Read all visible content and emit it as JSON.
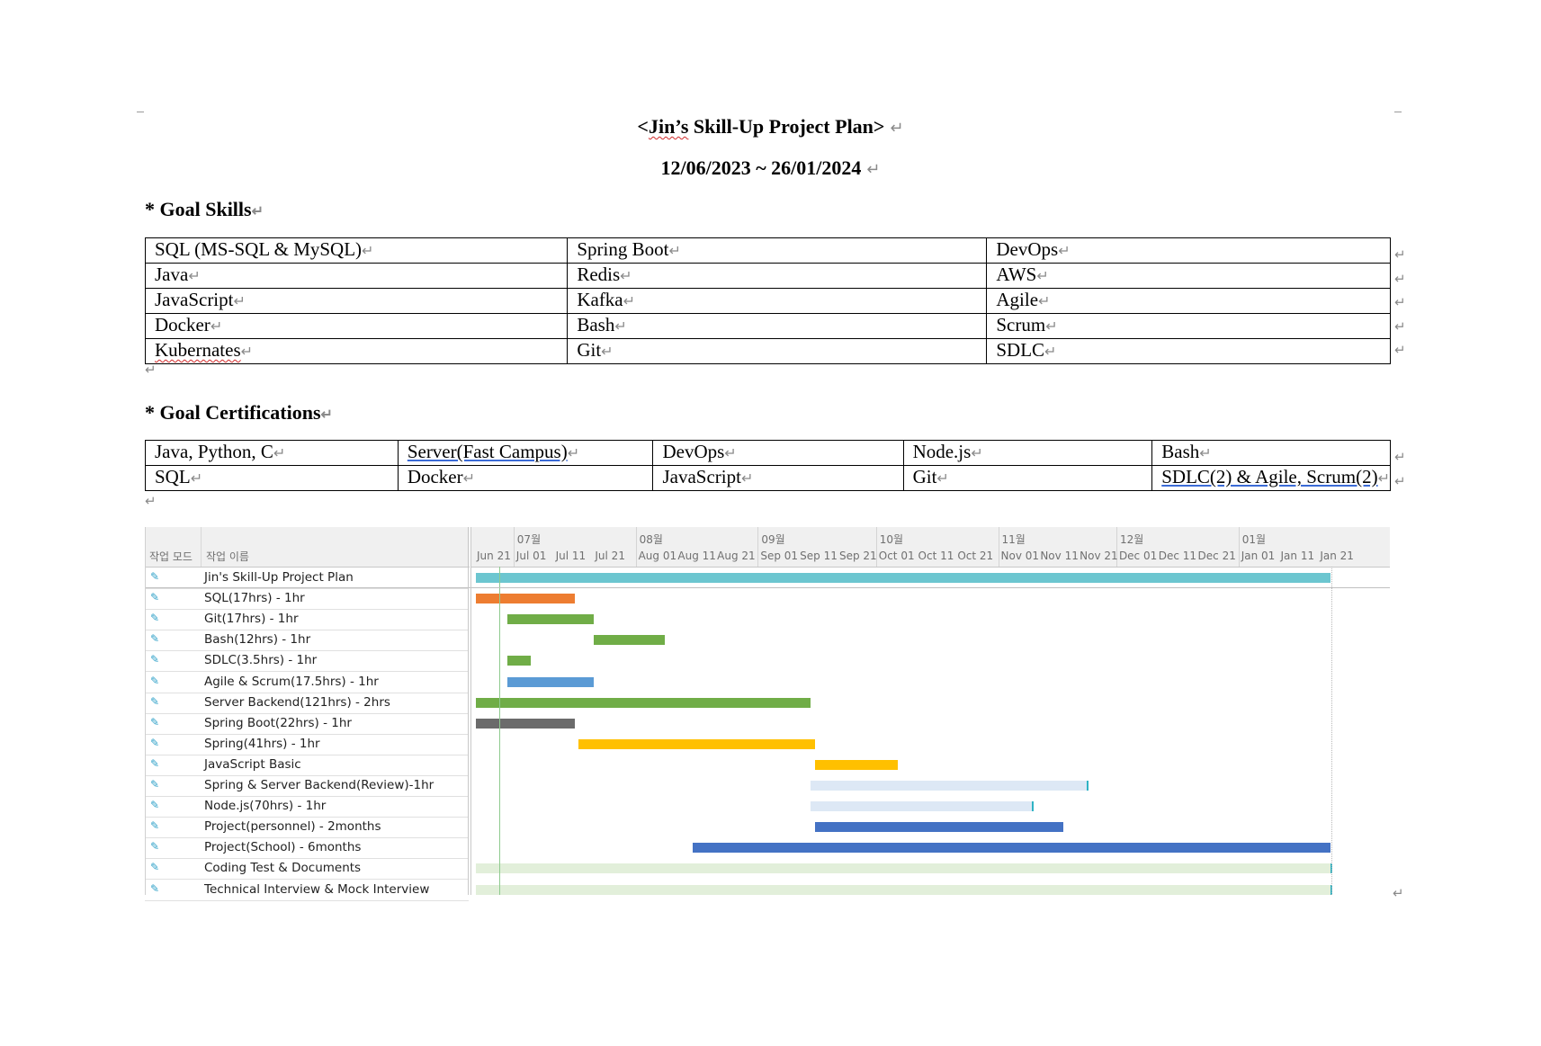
{
  "title": "<Jin’s Skill-Up Project Plan>",
  "date_range": "12/06/2023 ~ 26/01/2024",
  "goal_skills": {
    "heading": "* Goal Skills",
    "rows": [
      [
        "SQL (MS-SQL & MySQL)",
        "Spring Boot",
        "DevOps"
      ],
      [
        "Java",
        "Redis",
        "AWS"
      ],
      [
        "JavaScript",
        "Kafka",
        "Agile"
      ],
      [
        "Docker",
        "Bash",
        "Scrum"
      ],
      [
        "Kubernates",
        "Git",
        "SDLC"
      ]
    ]
  },
  "goal_certifications": {
    "heading": "* Goal Certifications",
    "rows": [
      [
        "Java, Python, C",
        "Server(Fast Campus)",
        "DevOps",
        "Node.js",
        "Bash"
      ],
      [
        "SQL",
        "Docker",
        "JavaScript",
        "Git",
        "SDLC(2) & Agile, Scrum(2)"
      ]
    ]
  },
  "gantt": {
    "col_mode": "작업 모드",
    "col_name": "작업 이름",
    "months": [
      "07월",
      "08월",
      "09월",
      "10월",
      "11월",
      "12월",
      "01월"
    ],
    "ticks": [
      "Jun 21",
      "Jul 01",
      "Jul 11",
      "Jul 21",
      "Aug 01",
      "Aug 11",
      "Aug 21",
      "Sep 01",
      "Sep 11",
      "Sep 21",
      "Oct 01",
      "Oct 11",
      "Oct 21",
      "Nov 01",
      "Nov 11",
      "Nov 21",
      "Dec 01",
      "Dec 11",
      "Dec 21",
      "Jan 01",
      "Jan 11",
      "Jan 21"
    ],
    "tasks": [
      {
        "name": "Jin's Skill-Up Project Plan",
        "start": "2023-06-21",
        "end": "2024-01-24",
        "color": "#6cc6d0"
      },
      {
        "name": "SQL(17hrs) - 1hr",
        "start": "2023-06-21",
        "end": "2023-07-16",
        "color": "#ed7d31"
      },
      {
        "name": "Git(17hrs) - 1hr",
        "start": "2023-06-29",
        "end": "2023-07-21",
        "color": "#70ad47"
      },
      {
        "name": "Bash(12hrs) - 1hr",
        "start": "2023-07-21",
        "end": "2023-08-08",
        "color": "#70ad47"
      },
      {
        "name": "SDLC(3.5hrs) - 1hr",
        "start": "2023-06-29",
        "end": "2023-07-05",
        "color": "#70ad47"
      },
      {
        "name": "Agile & Scrum(17.5hrs)  - 1hr",
        "start": "2023-06-29",
        "end": "2023-07-21",
        "color": "#5b9bd5"
      },
      {
        "name": "Server Backend(121hrs) - 2hrs",
        "start": "2023-06-21",
        "end": "2023-09-14",
        "color": "#70ad47"
      },
      {
        "name": "Spring Boot(22hrs) - 1hr",
        "start": "2023-06-21",
        "end": "2023-07-16",
        "color": "#6b6b6b"
      },
      {
        "name": "Spring(41hrs) - 1hr",
        "start": "2023-07-17",
        "end": "2023-09-15",
        "color": "#ffc000"
      },
      {
        "name": "JavaScript Basic",
        "start": "2023-09-15",
        "end": "2023-10-06",
        "color": "#ffc000"
      },
      {
        "name": "Spring & Server Backend(Review)-1hr",
        "start": "2023-09-14",
        "end": "2023-11-23",
        "color": "#dde8f5"
      },
      {
        "name": "Node.js(70hrs) - 1hr",
        "start": "2023-09-14",
        "end": "2023-11-09",
        "color": "#dde8f5"
      },
      {
        "name": "Project(personnel) - 2months",
        "start": "2023-09-15",
        "end": "2023-11-17",
        "color": "#4472c4"
      },
      {
        "name": "Project(School) - 6months",
        "start": "2023-08-15",
        "end": "2024-01-24",
        "color": "#4472c4"
      },
      {
        "name": "Coding Test & Documents",
        "start": "2023-06-21",
        "end": "2024-01-24",
        "color": "#e2efda"
      },
      {
        "name": "Technical Interview & Mock Interview",
        "start": "2023-06-21",
        "end": "2024-01-24",
        "color": "#e2efda"
      }
    ]
  }
}
